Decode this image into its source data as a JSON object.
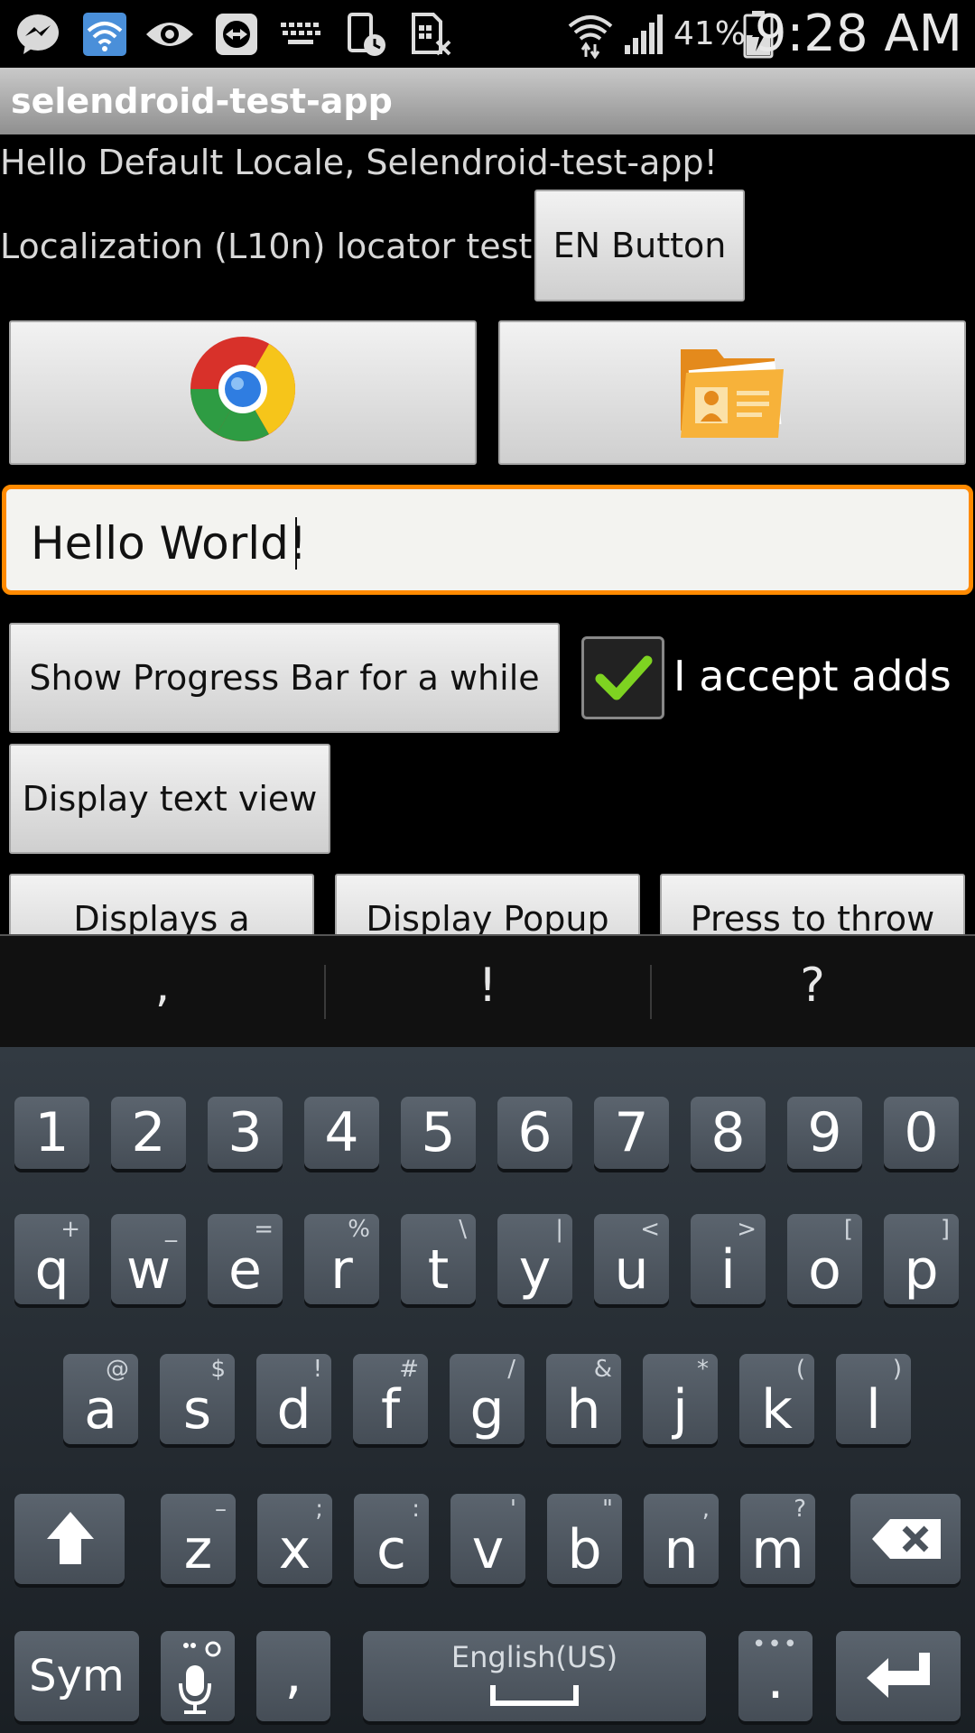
{
  "status_bar": {
    "icons": [
      "messenger-icon",
      "wifi-notification-icon",
      "eye-icon",
      "remote-icon",
      "keyboard-icon",
      "phone-clock-icon",
      "sim-icon",
      "wifi-icon",
      "signal-icon",
      "battery-icon"
    ],
    "battery_percent": "41%",
    "time": "9:28 AM"
  },
  "app": {
    "title": "selendroid-test-app",
    "hello_text": "Hello Default Locale, Selendroid-test-app!",
    "l10n_label": "Localization (L10n) locator test",
    "en_button": "EN Button",
    "image_buttons": [
      "chrome-icon",
      "contacts-folder-icon"
    ],
    "text_input_value": "Hello World!",
    "progress_button": "Show Progress Bar for a while",
    "checkbox_label": "I accept adds",
    "checkbox_checked": true,
    "display_text_button": "Display text view",
    "bottom_buttons": [
      "Displays a",
      "Display Popup",
      "Press to throw"
    ]
  },
  "keyboard": {
    "suggestions": [
      ",",
      "!",
      "?"
    ],
    "row_numbers": [
      "1",
      "2",
      "3",
      "4",
      "5",
      "6",
      "7",
      "8",
      "9",
      "0"
    ],
    "row_q": [
      {
        "k": "q",
        "s": "+"
      },
      {
        "k": "w",
        "s": "_"
      },
      {
        "k": "e",
        "s": "="
      },
      {
        "k": "r",
        "s": "%"
      },
      {
        "k": "t",
        "s": "\\"
      },
      {
        "k": "y",
        "s": "|"
      },
      {
        "k": "u",
        "s": "<"
      },
      {
        "k": "i",
        "s": ">"
      },
      {
        "k": "o",
        "s": "["
      },
      {
        "k": "p",
        "s": "]"
      }
    ],
    "row_a": [
      {
        "k": "a",
        "s": "@"
      },
      {
        "k": "s",
        "s": "$"
      },
      {
        "k": "d",
        "s": "!"
      },
      {
        "k": "f",
        "s": "#"
      },
      {
        "k": "g",
        "s": "/"
      },
      {
        "k": "h",
        "s": "&"
      },
      {
        "k": "j",
        "s": "*"
      },
      {
        "k": "k",
        "s": "("
      },
      {
        "k": "l",
        "s": ")"
      }
    ],
    "row_z": [
      {
        "k": "z",
        "s": "–"
      },
      {
        "k": "x",
        "s": ";"
      },
      {
        "k": "c",
        "s": ":"
      },
      {
        "k": "v",
        "s": "'"
      },
      {
        "k": "b",
        "s": "\""
      },
      {
        "k": "n",
        "s": ","
      },
      {
        "k": "m",
        "s": "?"
      }
    ],
    "sym": "Sym",
    "comma": ",",
    "space_label": "English(US)",
    "period": "."
  },
  "colors": {
    "focus_border": "#ff8a00",
    "check": "#7ed321"
  }
}
